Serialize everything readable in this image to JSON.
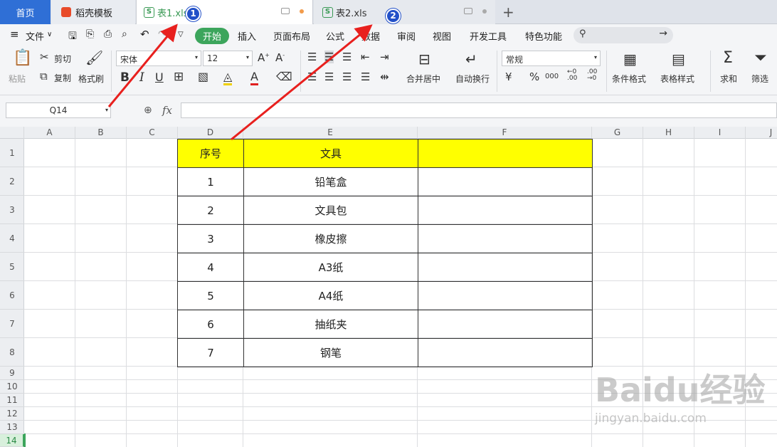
{
  "tabs": {
    "home": "首页",
    "template": "稻壳模板",
    "sheet1": "表1.xls",
    "sheet2": "表2.xls",
    "sheet_icon": "S",
    "new_tab": "+"
  },
  "menu": {
    "file": "文件",
    "items": [
      "开始",
      "插入",
      "页面布局",
      "公式",
      "数据",
      "审阅",
      "视图",
      "开发工具",
      "特色功能"
    ]
  },
  "ribbon": {
    "paste": "粘贴",
    "cut": "剪切",
    "copy": "复制",
    "format_painter": "格式刷",
    "font_name": "宋体",
    "font_size": "12",
    "bold": "B",
    "italic": "I",
    "underline": "U",
    "merge_center": "合并居中",
    "wrap_text": "自动换行",
    "number_format": "常规",
    "currency": "¥",
    "percent": "%",
    "thousands": "000",
    "cond_format": "条件格式",
    "table_style": "表格样式",
    "sum": "求和",
    "filter": "筛选"
  },
  "formula_bar": {
    "name_box": "Q14",
    "fx": "fx"
  },
  "grid": {
    "columns": [
      "A",
      "B",
      "C",
      "D",
      "E",
      "F",
      "G",
      "H",
      "I",
      "J"
    ],
    "rows": [
      "1",
      "2",
      "3",
      "4",
      "5",
      "6",
      "7",
      "8",
      "9",
      "10",
      "11",
      "12",
      "13",
      "14"
    ]
  },
  "table": {
    "headers": [
      "序号",
      "文具",
      ""
    ],
    "rows": [
      [
        "1",
        "铅笔盒",
        ""
      ],
      [
        "2",
        "文具包",
        ""
      ],
      [
        "3",
        "橡皮擦",
        ""
      ],
      [
        "4",
        "A3纸",
        ""
      ],
      [
        "5",
        "A4纸",
        ""
      ],
      [
        "6",
        "抽纸夹",
        ""
      ],
      [
        "7",
        "钢笔",
        ""
      ]
    ],
    "header_color": "#ffff00"
  },
  "annotations": {
    "marker1": "1",
    "marker2": "2",
    "arrow_color": "#e8201e",
    "marker_color": "#2250c8"
  },
  "watermark": {
    "logo": "Baidu经验",
    "url": "jingyan.baidu.com"
  }
}
